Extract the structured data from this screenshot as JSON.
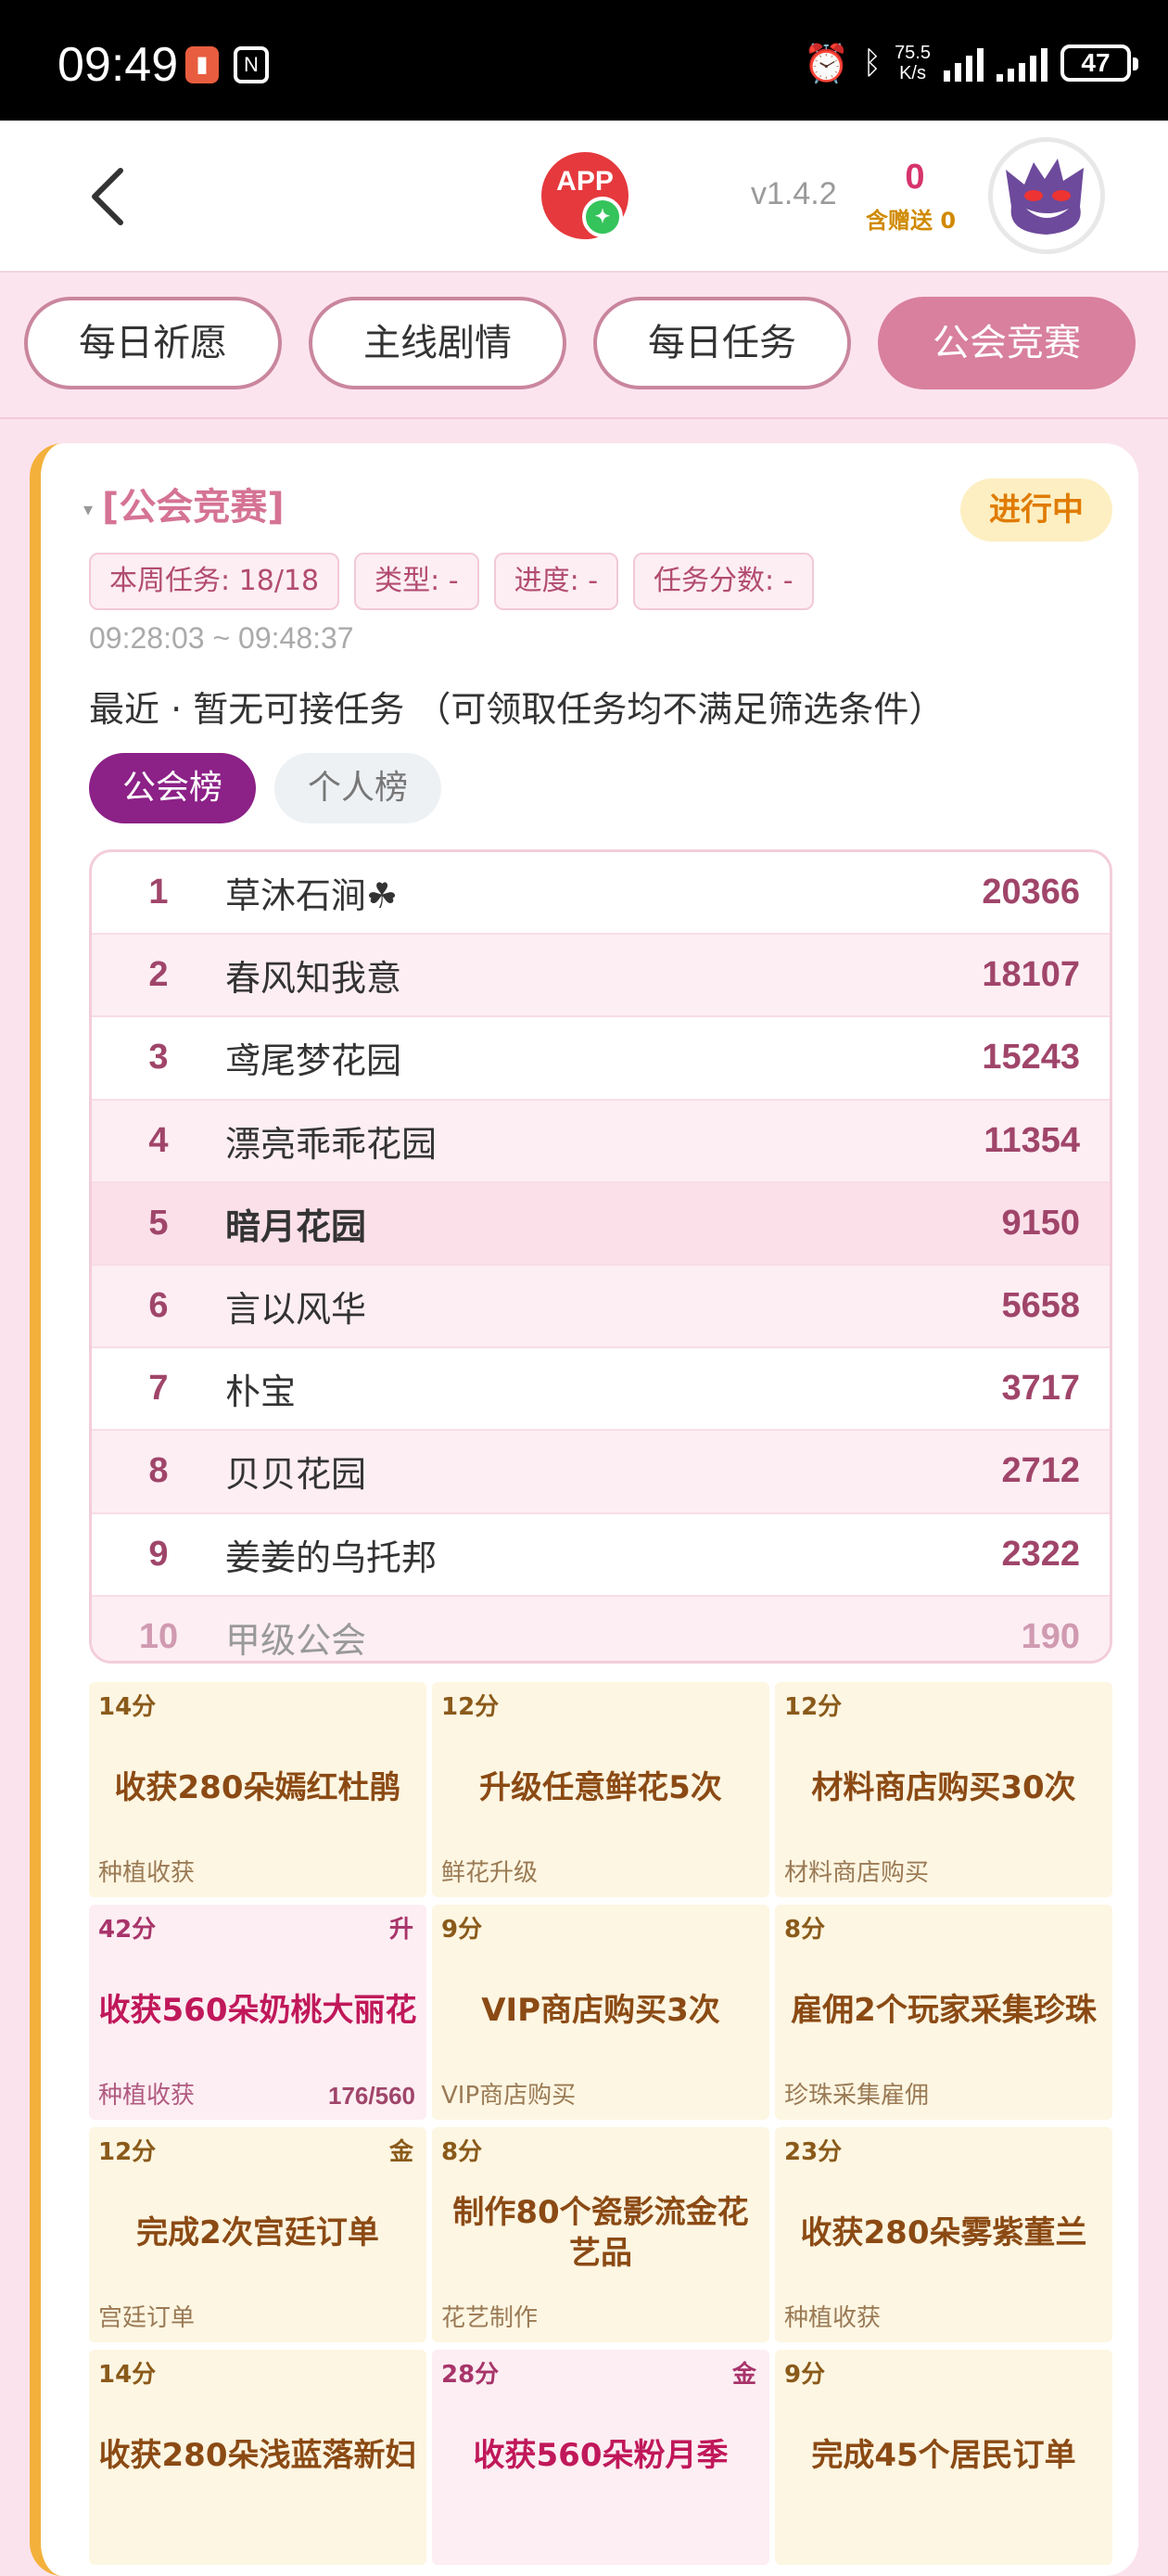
{
  "status_bar": {
    "time": "09:49",
    "notif_badge": "▮",
    "nfc": "N",
    "net_speed_value": "75.5",
    "net_speed_unit": "K/s",
    "battery": "47"
  },
  "header": {
    "app_logo": "APP",
    "version": "v1.4.2",
    "count": "0",
    "gift_label": "含赠送 0"
  },
  "tabs": [
    {
      "label": "每日祈愿",
      "active": false
    },
    {
      "label": "主线剧情",
      "active": false
    },
    {
      "label": "每日任务",
      "active": false
    },
    {
      "label": "公会竞赛",
      "active": true
    }
  ],
  "section": {
    "title": "[公会竞赛]",
    "status": "进行中",
    "chips": [
      "本周任务: 18/18",
      "类型: -",
      "进度: -",
      "任务分数: -"
    ],
    "time_range": "09:28:03 ~ 09:48:37",
    "recent": "最近 · 暂无可接任务 （可领取任务均不满足筛选条件）",
    "board_tabs": {
      "guild": "公会榜",
      "personal": "个人榜"
    }
  },
  "ranking": [
    {
      "rank": "1",
      "name": "草沐石涧☘",
      "score": "20366"
    },
    {
      "rank": "2",
      "name": "春风知我意",
      "score": "18107"
    },
    {
      "rank": "3",
      "name": "鸢尾梦花园",
      "score": "15243"
    },
    {
      "rank": "4",
      "name": "漂亮乖乖花园",
      "score": "11354"
    },
    {
      "rank": "5",
      "name": "暗月花园",
      "score": "9150"
    },
    {
      "rank": "6",
      "name": "言以风华",
      "score": "5658"
    },
    {
      "rank": "7",
      "name": "朴宝",
      "score": "3717"
    },
    {
      "rank": "8",
      "name": "贝贝花园",
      "score": "2712"
    },
    {
      "rank": "9",
      "name": "姜姜的乌托邦",
      "score": "2322"
    },
    {
      "rank": "10",
      "name": "甲级公会",
      "score": "190"
    }
  ],
  "tasks": [
    {
      "points": "14分",
      "title": "收获280朵嫣红杜鹃",
      "category": "种植收获",
      "tag": "",
      "progress": ""
    },
    {
      "points": "12分",
      "title": "升级任意鲜花5次",
      "category": "鲜花升级",
      "tag": "",
      "progress": ""
    },
    {
      "points": "12分",
      "title": "材料商店购买30次",
      "category": "材料商店购买",
      "tag": "",
      "progress": ""
    },
    {
      "points": "42分",
      "title": "收获560朵奶桃大丽花",
      "category": "种植收获",
      "tag": "升",
      "progress": "176/560"
    },
    {
      "points": "9分",
      "title": "VIP商店购买3次",
      "category": "VIP商店购买",
      "tag": "",
      "progress": ""
    },
    {
      "points": "8分",
      "title": "雇佣2个玩家采集珍珠",
      "category": "珍珠采集雇佣",
      "tag": "",
      "progress": ""
    },
    {
      "points": "12分",
      "title": "完成2次宫廷订单",
      "category": "宫廷订单",
      "tag": "金",
      "progress": ""
    },
    {
      "points": "8分",
      "title": "制作80个瓷影流金花艺品",
      "category": "花艺制作",
      "tag": "",
      "progress": ""
    },
    {
      "points": "23分",
      "title": "收获280朵雾紫董兰",
      "category": "种植收获",
      "tag": "",
      "progress": ""
    },
    {
      "points": "14分",
      "title": "收获280朵浅蓝落新妇",
      "category": "",
      "tag": "",
      "progress": ""
    },
    {
      "points": "28分",
      "title": "收获560朵粉月季",
      "category": "",
      "tag": "金",
      "progress": ""
    },
    {
      "points": "9分",
      "title": "完成45个居民订单",
      "category": "",
      "tag": "",
      "progress": ""
    }
  ],
  "colors": {
    "accent": "#d8809d",
    "board_active": "#8c2187",
    "status_pill": "#fdefc2",
    "card_border": "#f3b13c"
  }
}
